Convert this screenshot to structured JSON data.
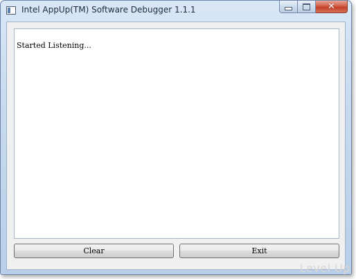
{
  "window": {
    "title": "Intel AppUp(TM) Software Debugger 1.1.1",
    "icons": {
      "app": "app-window-icon",
      "minimize": "minimize-icon",
      "maximize": "maximize-icon",
      "close": "close-icon"
    },
    "close_glyph": "✕"
  },
  "log": {
    "text": "Started Listening..."
  },
  "buttons": {
    "clear_label": "Clear",
    "exit_label": "Exit"
  },
  "watermark": {
    "text": "Level Up"
  },
  "colors": {
    "close_button": "#c24027",
    "frame": "#c6d9ef"
  }
}
